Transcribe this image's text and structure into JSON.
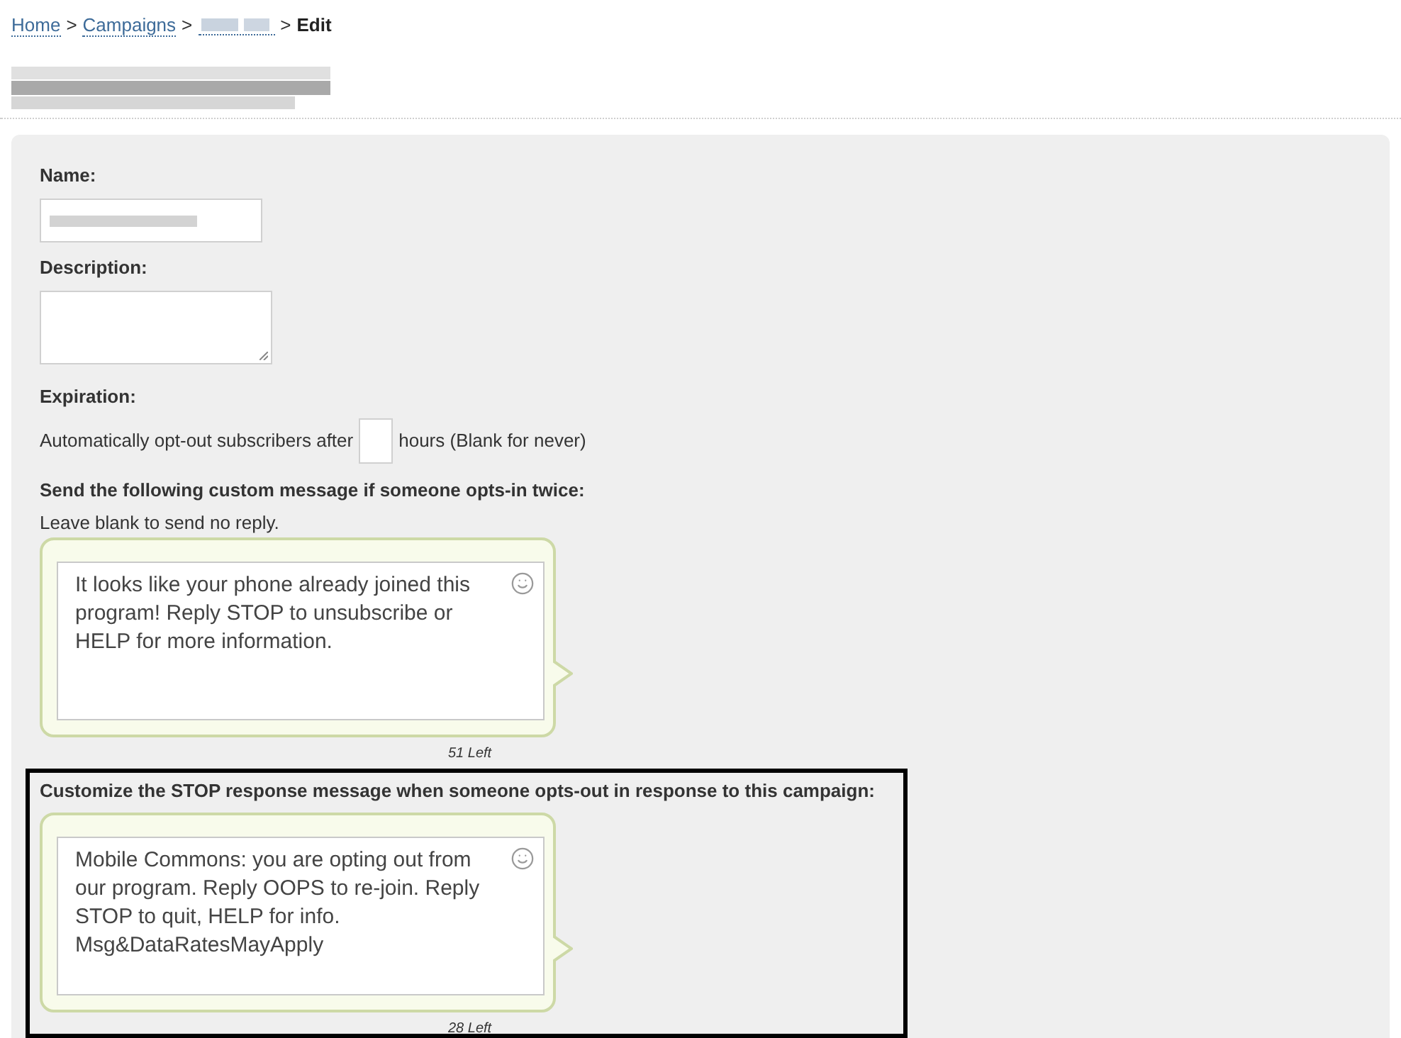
{
  "breadcrumb": [
    {
      "kind": "link",
      "label": "Home"
    },
    {
      "kind": "separator",
      "label": ">"
    },
    {
      "kind": "link",
      "label": "Campaigns"
    },
    {
      "kind": "separator",
      "label": ">"
    },
    {
      "kind": "redacted"
    },
    {
      "kind": "separator",
      "label": ">"
    },
    {
      "kind": "current",
      "label": "Edit"
    }
  ],
  "form": {
    "name": {
      "label": "Name:"
    },
    "description": {
      "label": "Description:"
    },
    "expiration": {
      "label": "Expiration:",
      "text_before": "Automatically opt-out subscribers after",
      "text_after": "hours (Blank for never)"
    },
    "opt_in_twice": {
      "label": "Send the following custom message if someone opts-in twice:",
      "hint": "Leave blank to send no reply.",
      "message": "It looks like your phone already joined this program! Reply STOP to unsubscribe or HELP for more information.",
      "counter": "51 Left",
      "highlighted": false
    },
    "stop_response": {
      "label": "Customize the STOP response message when someone opts-out in response to this campaign:",
      "message": "Mobile Commons: you are opting out from our program. Reply OOPS to re-join. Reply STOP to quit, HELP for info. Msg&DataRatesMayApply",
      "counter": "28 Left",
      "highlighted": true
    }
  }
}
